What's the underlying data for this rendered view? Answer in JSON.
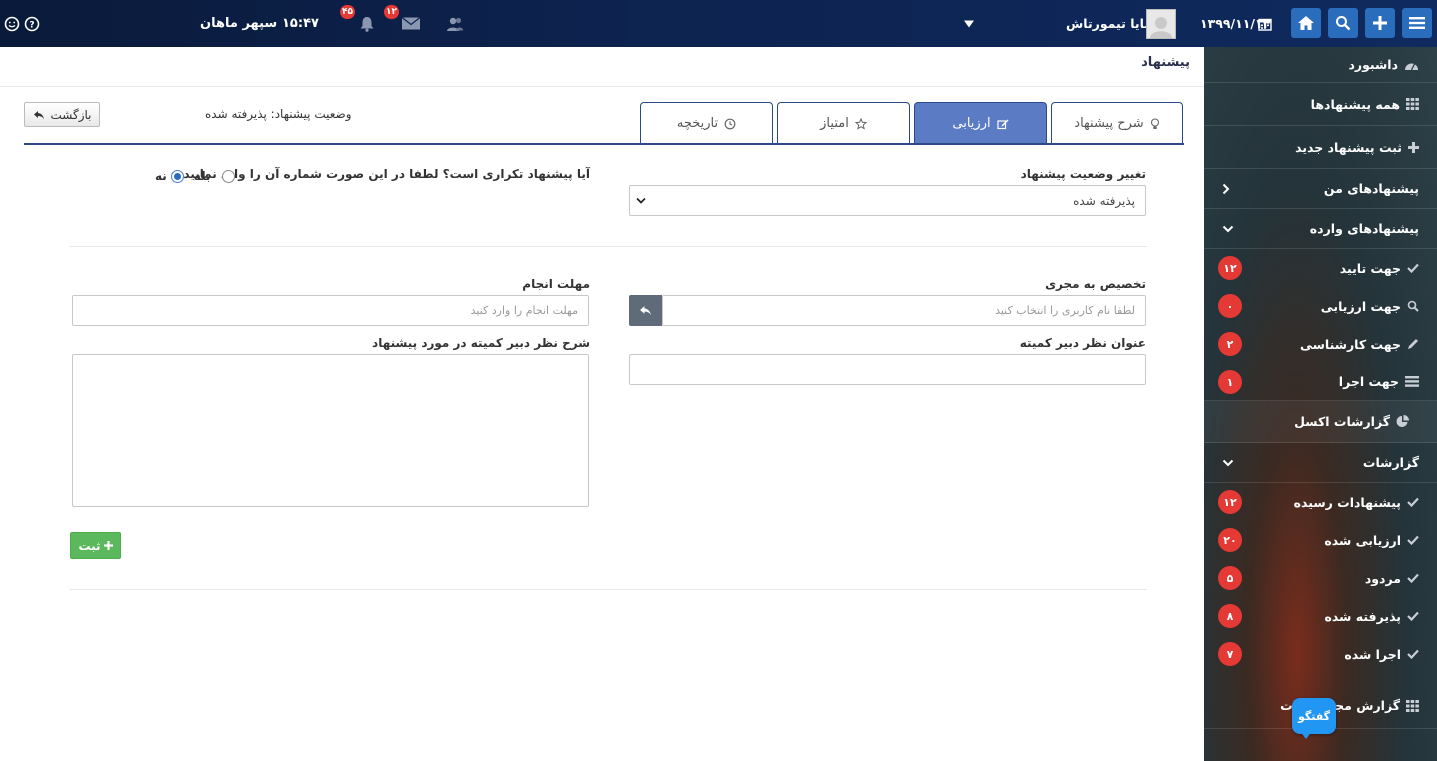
{
  "topbar": {
    "date": "۱۳۹۹/۱۱/۱۴",
    "user_name": "مایا تیمورتاش",
    "time": "۱۵:۴۷",
    "company": "سپهر ماهان",
    "notif_count": "۴۵",
    "mail_count": "۱۲"
  },
  "sidebar": {
    "items": [
      {
        "label": "داشبورد"
      },
      {
        "label": "همه پیشنهادها"
      },
      {
        "label": "ثبت پیشنهاد جدید"
      },
      {
        "label": "پیشنهادهای من"
      },
      {
        "label": "پیشنهادهای وارده"
      },
      {
        "label": "جهت تایید",
        "badge": "۱۲"
      },
      {
        "label": "جهت ارزیابی",
        "badge": "۰"
      },
      {
        "label": "جهت کارشناسی",
        "badge": "۲"
      },
      {
        "label": "جهت اجرا",
        "badge": "۱"
      },
      {
        "label": "گزارشات اکسل"
      },
      {
        "label": "گزارشات"
      },
      {
        "label": "پیشنهادات رسیده",
        "badge": "۱۲"
      },
      {
        "label": "ارزیابی شده",
        "badge": "۲۰"
      },
      {
        "label": "مردود",
        "badge": "۵"
      },
      {
        "label": "پذیرفته شده",
        "badge": "۸"
      },
      {
        "label": "اجرا شده",
        "badge": "۷"
      },
      {
        "label": "گزارش مجم   نهادات"
      }
    ],
    "chat_label": "گفتگو"
  },
  "main": {
    "page_title": "پیشنهاد",
    "tabs": [
      {
        "label": "شرح پیشنهاد"
      },
      {
        "label": "ارزیابی"
      },
      {
        "label": "امتیاز"
      },
      {
        "label": "تاریخچه"
      }
    ],
    "status_text": "وضعیت پیشنهاد: پذیرفته شده",
    "back_label": "بازگشت",
    "form": {
      "status_change_label": "تغییر وضعیت پیشنهاد",
      "status_change_value": "پذیرفته شده",
      "duplicate_question": "آیا پیشنهاد تکراری است؟ لطفا در این صورت شماره آن را وارد نمایید",
      "radio_yes": "بله",
      "radio_no": "نه",
      "assign_label": "تخصیص به مجری",
      "assign_placeholder": "لطفا نام کاربری را انتخاب کنید",
      "deadline_label": "مهلت انجام",
      "deadline_placeholder": "مهلت انجام را وارد کنید",
      "secretary_title_label": "عنوان نظر دبیر کمیته",
      "secretary_desc_label": "شرح نظر دبیر کمیته در مورد پیشنهاد",
      "submit_label": "ثبت"
    }
  },
  "colors": {
    "accent": "#5b7cc4",
    "badge": "#e53935",
    "submit": "#5cb85c"
  }
}
